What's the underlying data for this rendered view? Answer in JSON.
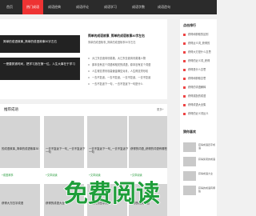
{
  "nav": {
    "items": [
      "首页",
      "热门成语",
      "成语经典",
      "成语评论",
      "成语学习",
      "成语字数",
      "成语造句"
    ]
  },
  "slider": {
    "captions": [
      "简单的成语故事_简单的成语故事30字左右",
      "一是要抓紧时间，把学习放在第一位。人生大事在于学习"
    ]
  },
  "featured": {
    "title": "简单的成语故事_简单的成语故事30字左右",
    "subtitle": "简单的成语故事_简单的成语故事30字左右",
    "list": [
      "大江东去浪淘尽英雄，大江东去浪淘尽英雄人物",
      "原本没有这个词语和相关的成语，原本没有这个词语",
      "人生得意须尽欢莫使金樽空对月，人生得意须尽欢",
      "一去不复返，一去不复返，一去不复返，一去不复返",
      "一去不复返下一句，一去不复返下一句是什么"
    ]
  },
  "section": {
    "title": "推荐成语",
    "more": "更多+"
  },
  "cards": [
    {
      "title": "的成语故事_简单的成语故事30",
      "tag": "+成语故事"
    },
    {
      "title": "一去不复返下一句_一去不复返下一句",
      "tag": "+文章阅读"
    },
    {
      "title": "一去不复返下一句_一去不复返下一句",
      "tag": "+文章阅读"
    },
    {
      "title": "获得的词语_获得的词语有哪些",
      "tag": "+文章阅读"
    }
  ],
  "row2": [
    {
      "title": "获得大方四字成语"
    },
    {
      "title": "获得的成语大全"
    },
    {
      "title": "获得大方四字成语"
    },
    {
      "title": "获得的相关成语"
    }
  ],
  "sidebar": {
    "heading": "点击排行",
    "items": [
      "获得和获取的区别",
      "获得近义词_获得的",
      "获得大方是什么意思",
      "获得的近义词_获得",
      "获得是什么意思",
      "获得和获取意思",
      "获得的词语解释",
      "获得奖励的成语",
      "获得成语大全集",
      "获得的近义词反义"
    ],
    "heading2": "猜你喜欢",
    "thumbs": [
      "获得成语四字成语",
      "获得奖项的成语",
      "获得成语大全",
      "获得的成语有哪些"
    ]
  },
  "watermark": {
    "text": "免费阅读"
  }
}
